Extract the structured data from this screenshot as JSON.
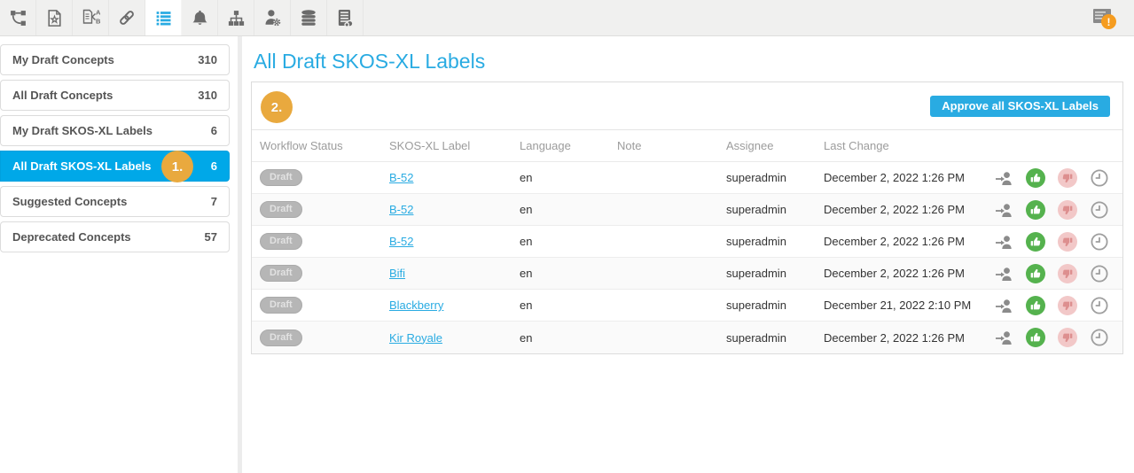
{
  "toolbar": {
    "icons": [
      {
        "name": "relations-curve-icon"
      },
      {
        "name": "document-star-icon"
      },
      {
        "name": "document-ab-classify-icon"
      },
      {
        "name": "link-icon"
      },
      {
        "name": "list-icon",
        "active": true
      },
      {
        "name": "bell-icon"
      },
      {
        "name": "sitemap-icon"
      },
      {
        "name": "user-settings-icon"
      },
      {
        "name": "database-icon"
      },
      {
        "name": "server-cloud-icon"
      }
    ],
    "notification": {
      "icon": "notification-panel-icon",
      "badge": "!"
    }
  },
  "sidebar": {
    "items": [
      {
        "label": "My Draft Concepts",
        "count": "310"
      },
      {
        "label": "All Draft Concepts",
        "count": "310"
      },
      {
        "label": "My Draft SKOS-XL Labels",
        "count": "6"
      },
      {
        "label": "All Draft SKOS-XL Labels",
        "count": "6",
        "selected": true,
        "annotation": "1."
      },
      {
        "label": "Suggested Concepts",
        "count": "7"
      },
      {
        "label": "Deprecated Concepts",
        "count": "57"
      }
    ]
  },
  "main": {
    "title": "All Draft SKOS-XL Labels",
    "annotation": "2.",
    "approve_button": "Approve all SKOS-XL Labels",
    "table": {
      "headers": {
        "status": "Workflow Status",
        "label": "SKOS-XL Label",
        "language": "Language",
        "note": "Note",
        "assignee": "Assignee",
        "last_change": "Last Change"
      },
      "row_action_icons": [
        "assign-user-icon",
        "approve-thumbs-up-icon",
        "reject-thumbs-down-icon",
        "history-clock-icon"
      ],
      "rows": [
        {
          "status": "Draft",
          "label": "B-52",
          "language": "en",
          "note": "",
          "assignee": "superadmin",
          "last_change": "December 2, 2022 1:26 PM"
        },
        {
          "status": "Draft",
          "label": "B-52",
          "language": "en",
          "note": "",
          "assignee": "superadmin",
          "last_change": "December 2, 2022 1:26 PM"
        },
        {
          "status": "Draft",
          "label": "B-52",
          "language": "en",
          "note": "",
          "assignee": "superadmin",
          "last_change": "December 2, 2022 1:26 PM"
        },
        {
          "status": "Draft",
          "label": "Bifi",
          "language": "en",
          "note": "",
          "assignee": "superadmin",
          "last_change": "December 2, 2022 1:26 PM"
        },
        {
          "status": "Draft",
          "label": "Blackberry",
          "language": "en",
          "note": "",
          "assignee": "superadmin",
          "last_change": "December 21, 2022 2:10 PM"
        },
        {
          "status": "Draft",
          "label": "Kir Royale",
          "language": "en",
          "note": "",
          "assignee": "superadmin",
          "last_change": "December 2, 2022 1:26 PM"
        }
      ]
    }
  },
  "colors": {
    "accent_blue": "#29abe2",
    "selected_blue": "#00a8e8",
    "annotation_orange": "#e9a93e",
    "warning_orange": "#f59c20",
    "approve_green": "#55b24e",
    "reject_pink": "#f2c8c8",
    "draft_pill_gray": "#b6b6b6"
  }
}
